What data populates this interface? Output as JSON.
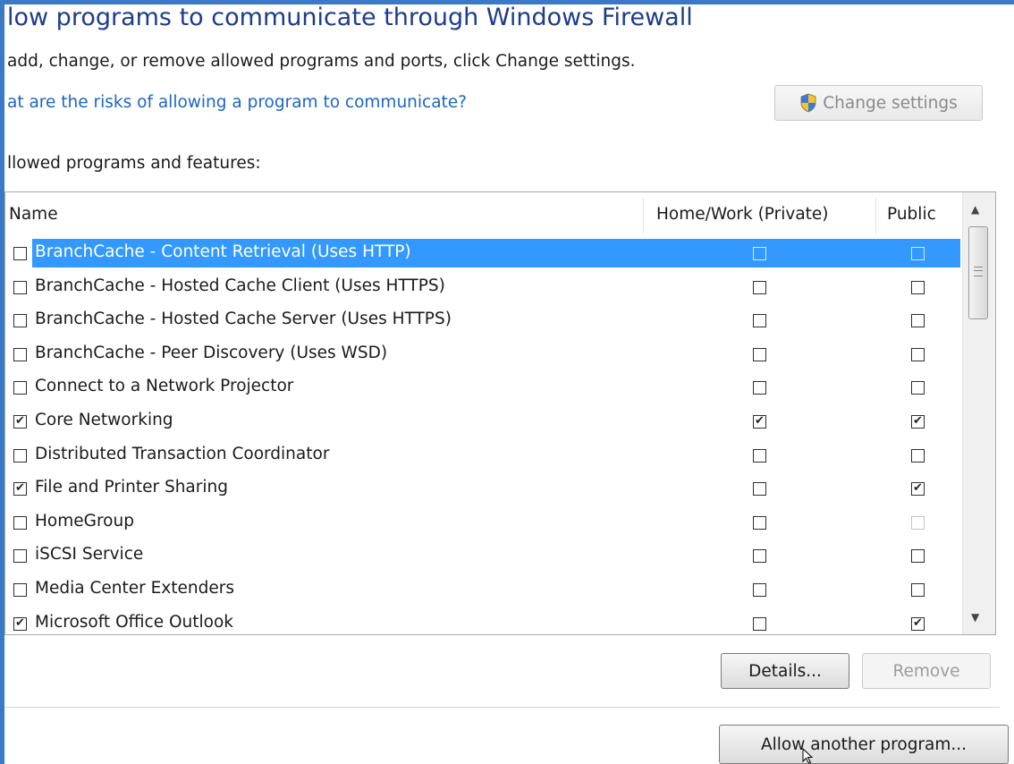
{
  "header": {
    "title": "low programs to communicate through Windows Firewall",
    "subtitle": "add, change, or remove allowed programs and ports, click Change settings.",
    "risks_link": "at are the risks of allowing a program to communicate?",
    "change_settings_label": "Change settings"
  },
  "allowed": {
    "section_label": "llowed programs and features:",
    "columns": {
      "name": "Name",
      "private": "Home/Work (Private)",
      "public": "Public"
    },
    "selected_index": 0,
    "rows": [
      {
        "label": "BranchCache - Content Retrieval (Uses HTTP)",
        "enabled": false,
        "private": false,
        "public": false,
        "public_disabled": false,
        "private_mark": "",
        "public_mark": "",
        "name_mark": ""
      },
      {
        "label": "BranchCache - Hosted Cache Client (Uses HTTPS)",
        "enabled": false,
        "private": false,
        "public": false,
        "public_disabled": false,
        "private_mark": "",
        "public_mark": "",
        "name_mark": ""
      },
      {
        "label": "BranchCache - Hosted Cache Server (Uses HTTPS)",
        "enabled": false,
        "private": false,
        "public": false,
        "public_disabled": false,
        "private_mark": "",
        "public_mark": "",
        "name_mark": ""
      },
      {
        "label": "BranchCache - Peer Discovery (Uses WSD)",
        "enabled": false,
        "private": false,
        "public": false,
        "public_disabled": false,
        "private_mark": "",
        "public_mark": "",
        "name_mark": ""
      },
      {
        "label": "Connect to a Network Projector",
        "enabled": false,
        "private": false,
        "public": false,
        "public_disabled": false,
        "private_mark": "",
        "public_mark": "",
        "name_mark": ""
      },
      {
        "label": "Core Networking",
        "enabled": true,
        "private": true,
        "public": true,
        "public_disabled": false,
        "private_mark": "✔",
        "public_mark": "✔",
        "name_mark": "✔"
      },
      {
        "label": "Distributed Transaction Coordinator",
        "enabled": false,
        "private": false,
        "public": false,
        "public_disabled": false,
        "private_mark": "",
        "public_mark": "",
        "name_mark": ""
      },
      {
        "label": "File and Printer Sharing",
        "enabled": true,
        "private": false,
        "public": true,
        "public_disabled": false,
        "private_mark": "",
        "public_mark": "✔",
        "name_mark": "✔"
      },
      {
        "label": "HomeGroup",
        "enabled": false,
        "private": false,
        "public": false,
        "public_disabled": true,
        "private_mark": "",
        "public_mark": "",
        "name_mark": ""
      },
      {
        "label": "iSCSI Service",
        "enabled": false,
        "private": false,
        "public": false,
        "public_disabled": false,
        "private_mark": "",
        "public_mark": "",
        "name_mark": ""
      },
      {
        "label": "Media Center Extenders",
        "enabled": false,
        "private": false,
        "public": false,
        "public_disabled": false,
        "private_mark": "",
        "public_mark": "",
        "name_mark": ""
      },
      {
        "label": "Microsoft Office Outlook",
        "enabled": true,
        "private": false,
        "public": true,
        "public_disabled": false,
        "private_mark": "",
        "public_mark": "✔",
        "name_mark": "✔"
      }
    ]
  },
  "buttons": {
    "details": "Details...",
    "remove": "Remove",
    "allow_another": "Allow another program..."
  },
  "colors": {
    "selection": "#3399ff",
    "link": "#1b66c4",
    "title": "#1e3c8c",
    "window_border": "#3b78c7"
  }
}
